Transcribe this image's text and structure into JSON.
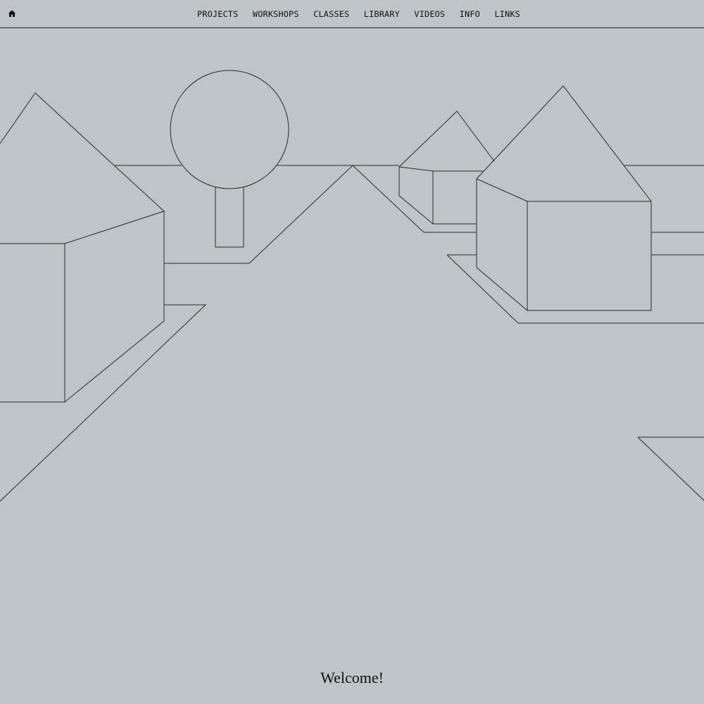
{
  "header": {
    "home_icon": "home-icon",
    "nav": [
      "PROJECTS",
      "WORKSHOPS",
      "CLASSES",
      "LIBRARY",
      "VIDEOS",
      "INFO",
      "LINKS"
    ]
  },
  "main": {
    "illustration": "line-drawing-village",
    "welcome_text": "Welcome!"
  },
  "colors": {
    "background": "#bec5c8",
    "line": "#2a2a2a",
    "text": "#111111"
  }
}
